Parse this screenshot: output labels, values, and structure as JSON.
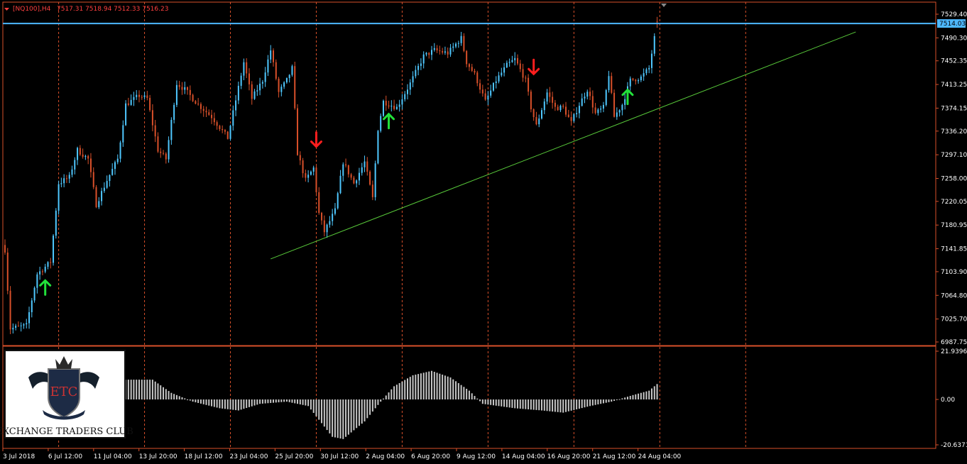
{
  "header": {
    "symbol": "[NQ100],H4",
    "ohlc": "7517.31 7518.94 7512.33 7516.23"
  },
  "logo": {
    "monogram": "ETC",
    "caption": "EXCHANGE TRADERS CLUB"
  },
  "colors": {
    "background": "#000000",
    "bull": "#4fc8ff",
    "bear": "#d9502a",
    "grid": "#d9502a",
    "current_price_line": "#4db8ff",
    "trendline": "#58c93a",
    "arrow_up": "#22e03a",
    "arrow_down": "#ff1e1e",
    "histogram": "#c8c8c8",
    "axis_text": "#ffffff",
    "header_text": "#ff4040"
  },
  "chart_data": [
    {
      "type": "candlestick",
      "title": "[NQ100],H4",
      "timeframe": "H4",
      "ylim": [
        6987.75,
        7529.4
      ],
      "y_ticks": [
        "7529.40",
        "7490.30",
        "7452.35",
        "7413.25",
        "7374.15",
        "7336.20",
        "7297.10",
        "7258.00",
        "7220.05",
        "7180.95",
        "7141.85",
        "7103.90",
        "7064.80",
        "7025.70",
        "6987.75"
      ],
      "x_tick_labels": [
        "3 Jul 2018",
        "6 Jul 12:00",
        "11 Jul 04:00",
        "13 Jul 20:00",
        "18 Jul 12:00",
        "23 Jul 04:00",
        "25 Jul 20:00",
        "30 Jul 12:00",
        "2 Aug 04:00",
        "6 Aug 20:00",
        "9 Aug 12:00",
        "14 Aug 04:00",
        "16 Aug 20:00",
        "21 Aug 12:00",
        "24 Aug 04:00"
      ],
      "current_price": 7514.03,
      "current_price_label": "7514.03",
      "last_ohlc": {
        "open": 7517.31,
        "high": 7518.94,
        "low": 7512.33,
        "close": 7516.23
      },
      "close_path": [
        {
          "bar": 0,
          "close": 7140
        },
        {
          "bar": 2,
          "close": 7010
        },
        {
          "bar": 8,
          "close": 7015
        },
        {
          "bar": 12,
          "close": 7100
        },
        {
          "bar": 17,
          "close": 7120
        },
        {
          "bar": 20,
          "close": 7250
        },
        {
          "bar": 24,
          "close": 7260
        },
        {
          "bar": 27,
          "close": 7305
        },
        {
          "bar": 31,
          "close": 7290
        },
        {
          "bar": 34,
          "close": 7215
        },
        {
          "bar": 38,
          "close": 7255
        },
        {
          "bar": 42,
          "close": 7290
        },
        {
          "bar": 45,
          "close": 7380
        },
        {
          "bar": 50,
          "close": 7395
        },
        {
          "bar": 53,
          "close": 7390
        },
        {
          "bar": 57,
          "close": 7305
        },
        {
          "bar": 60,
          "close": 7290
        },
        {
          "bar": 64,
          "close": 7415
        },
        {
          "bar": 67,
          "close": 7405
        },
        {
          "bar": 72,
          "close": 7380
        },
        {
          "bar": 77,
          "close": 7360
        },
        {
          "bar": 83,
          "close": 7325
        },
        {
          "bar": 89,
          "close": 7450
        },
        {
          "bar": 92,
          "close": 7390
        },
        {
          "bar": 96,
          "close": 7420
        },
        {
          "bar": 99,
          "close": 7470
        },
        {
          "bar": 102,
          "close": 7400
        },
        {
          "bar": 105,
          "close": 7420
        },
        {
          "bar": 107,
          "close": 7440
        },
        {
          "bar": 109,
          "close": 7300
        },
        {
          "bar": 112,
          "close": 7255
        },
        {
          "bar": 115,
          "close": 7275
        },
        {
          "bar": 117,
          "close": 7200
        },
        {
          "bar": 119,
          "close": 7170
        },
        {
          "bar": 123,
          "close": 7205
        },
        {
          "bar": 126,
          "close": 7285
        },
        {
          "bar": 130,
          "close": 7250
        },
        {
          "bar": 134,
          "close": 7285
        },
        {
          "bar": 137,
          "close": 7225
        },
        {
          "bar": 139,
          "close": 7340
        },
        {
          "bar": 141,
          "close": 7385
        },
        {
          "bar": 146,
          "close": 7375
        },
        {
          "bar": 151,
          "close": 7415
        },
        {
          "bar": 156,
          "close": 7460
        },
        {
          "bar": 160,
          "close": 7470
        },
        {
          "bar": 165,
          "close": 7465
        },
        {
          "bar": 170,
          "close": 7490
        },
        {
          "bar": 172,
          "close": 7450
        },
        {
          "bar": 175,
          "close": 7430
        },
        {
          "bar": 179,
          "close": 7385
        },
        {
          "bar": 183,
          "close": 7420
        },
        {
          "bar": 187,
          "close": 7445
        },
        {
          "bar": 190,
          "close": 7455
        },
        {
          "bar": 194,
          "close": 7420
        },
        {
          "bar": 196,
          "close": 7375
        },
        {
          "bar": 198,
          "close": 7345
        },
        {
          "bar": 202,
          "close": 7400
        },
        {
          "bar": 205,
          "close": 7375
        },
        {
          "bar": 208,
          "close": 7375
        },
        {
          "bar": 211,
          "close": 7350
        },
        {
          "bar": 214,
          "close": 7380
        },
        {
          "bar": 217,
          "close": 7405
        },
        {
          "bar": 220,
          "close": 7365
        },
        {
          "bar": 223,
          "close": 7375
        },
        {
          "bar": 225,
          "close": 7430
        },
        {
          "bar": 227,
          "close": 7360
        },
        {
          "bar": 230,
          "close": 7380
        },
        {
          "bar": 233,
          "close": 7420
        },
        {
          "bar": 237,
          "close": 7425
        },
        {
          "bar": 240,
          "close": 7440
        },
        {
          "bar": 242,
          "close": 7490
        },
        {
          "bar": 243,
          "close": 7516
        }
      ],
      "trendline": {
        "from": {
          "bar": 99,
          "price": 7125
        },
        "to": {
          "bar": 317,
          "price": 7500
        }
      },
      "signals": [
        {
          "bar": 15,
          "direction": "up",
          "price": 7080
        },
        {
          "bar": 116,
          "direction": "down",
          "price": 7320
        },
        {
          "bar": 143,
          "direction": "up",
          "price": 7355
        },
        {
          "bar": 197,
          "direction": "down",
          "price": 7440
        },
        {
          "bar": 232,
          "direction": "up",
          "price": 7395
        }
      ],
      "vertical_grid_bars": [
        20,
        52,
        84,
        116,
        148,
        180,
        212,
        244,
        276
      ]
    },
    {
      "type": "bar",
      "title": "",
      "ylim": [
        -20.6371,
        21.9396
      ],
      "y_ticks": [
        "21.9396",
        "0.00",
        "-20.6371"
      ],
      "histogram_path": [
        {
          "bar": 0,
          "value": -2
        },
        {
          "bar": 45,
          "value": 9
        },
        {
          "bar": 55,
          "value": 9
        },
        {
          "bar": 62,
          "value": 3
        },
        {
          "bar": 70,
          "value": -1
        },
        {
          "bar": 80,
          "value": -4
        },
        {
          "bar": 87,
          "value": -5
        },
        {
          "bar": 95,
          "value": -2
        },
        {
          "bar": 105,
          "value": -1
        },
        {
          "bar": 113,
          "value": -3
        },
        {
          "bar": 122,
          "value": -17
        },
        {
          "bar": 126,
          "value": -18
        },
        {
          "bar": 134,
          "value": -10
        },
        {
          "bar": 140,
          "value": -1
        },
        {
          "bar": 145,
          "value": 6
        },
        {
          "bar": 152,
          "value": 11
        },
        {
          "bar": 159,
          "value": 13
        },
        {
          "bar": 166,
          "value": 10
        },
        {
          "bar": 173,
          "value": 4
        },
        {
          "bar": 178,
          "value": -2
        },
        {
          "bar": 190,
          "value": -4
        },
        {
          "bar": 200,
          "value": -5
        },
        {
          "bar": 208,
          "value": -6
        },
        {
          "bar": 218,
          "value": -3
        },
        {
          "bar": 226,
          "value": -1
        },
        {
          "bar": 234,
          "value": 2
        },
        {
          "bar": 240,
          "value": 4
        },
        {
          "bar": 243,
          "value": 7
        }
      ]
    }
  ]
}
